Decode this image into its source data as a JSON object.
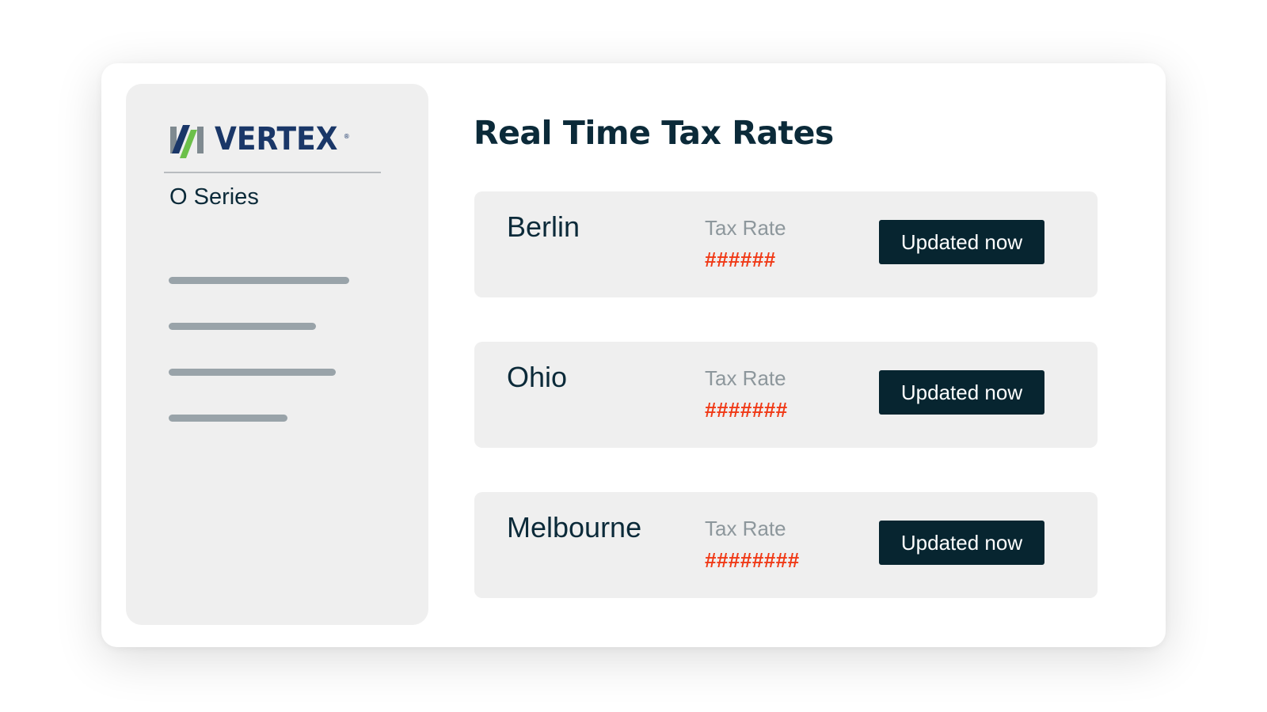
{
  "brand": {
    "name": "VERTEX",
    "registered_mark": "®",
    "product": "O Series",
    "colors": {
      "navy": "#1a3768",
      "gray": "#7f8a90",
      "green": "#6cc04a"
    }
  },
  "sidebar": {
    "nav_items": [
      {
        "placeholder": true
      },
      {
        "placeholder": true
      },
      {
        "placeholder": true
      },
      {
        "placeholder": true
      }
    ]
  },
  "main": {
    "title": "Real Time Tax Rates",
    "rows": [
      {
        "city": "Berlin",
        "label": "Tax Rate",
        "value": "######",
        "status": "Updated now"
      },
      {
        "city": "Ohio",
        "label": "Tax Rate",
        "value": "#######",
        "status": "Updated now"
      },
      {
        "city": "Melbourne",
        "label": "Tax Rate",
        "value": "########",
        "status": "Updated now"
      }
    ]
  },
  "colors": {
    "accent_red": "#f03a17",
    "button_bg": "#072530",
    "text_dark": "#0b2a39",
    "text_muted": "#8d979c",
    "panel_bg": "#efefef"
  }
}
